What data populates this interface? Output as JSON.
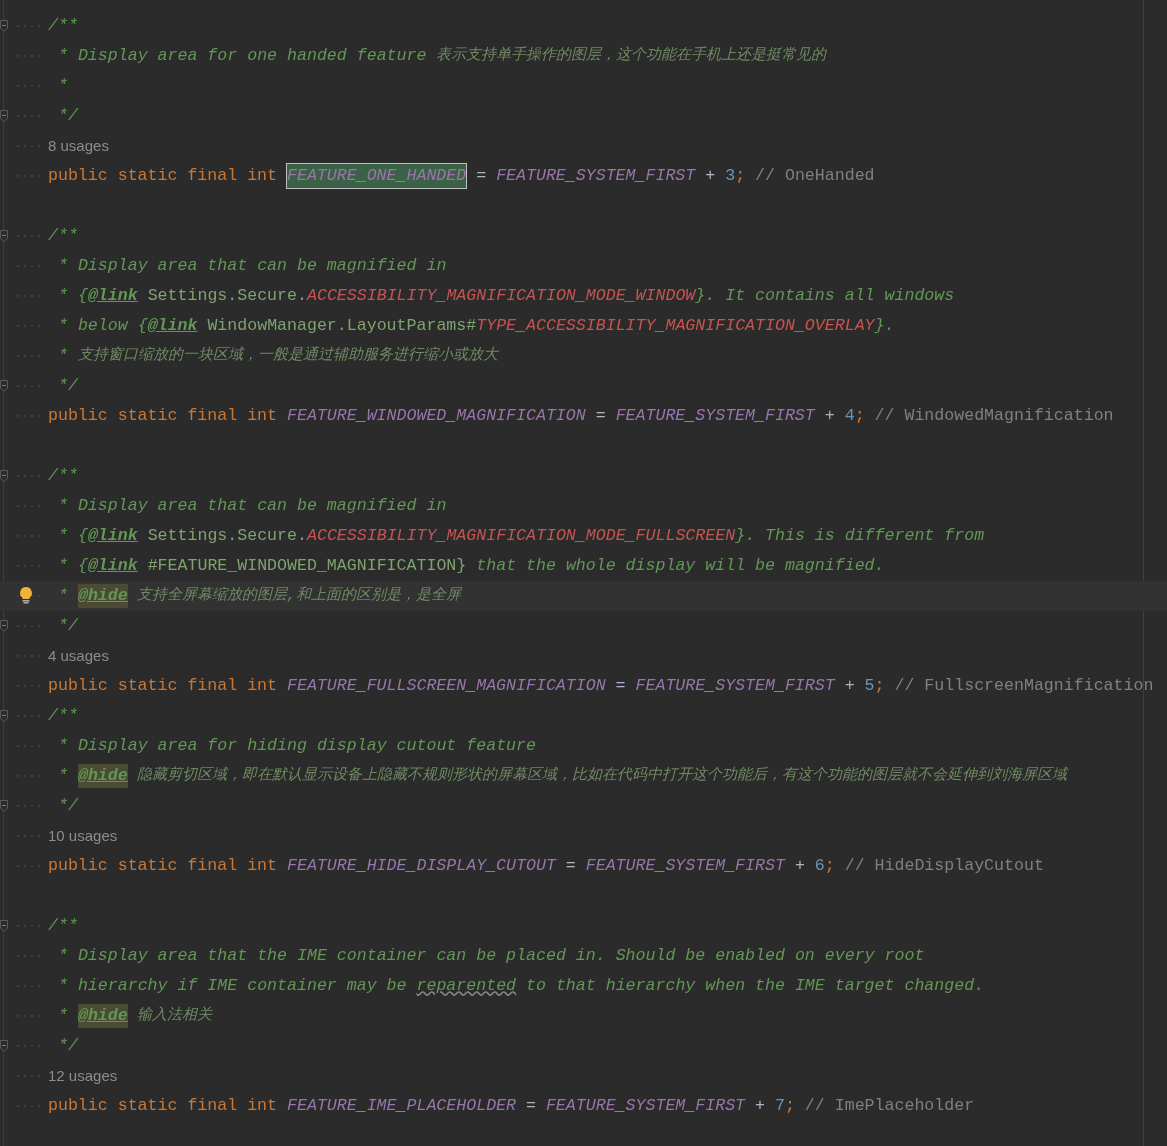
{
  "editor": {
    "lines": [
      {
        "kind": "doc_open",
        "tokens": [
          {
            "kind": "comment",
            "text": "/**"
          }
        ]
      },
      {
        "kind": "doc",
        "tokens": [
          {
            "kind": "comment",
            "text": "* Display area for one handed feature "
          },
          {
            "kind": "cn",
            "text": "表示支持单手操作的图层，这个功能在手机上还是挺常见的"
          }
        ]
      },
      {
        "kind": "doc",
        "tokens": [
          {
            "kind": "comment",
            "text": "*"
          }
        ]
      },
      {
        "kind": "doc_close",
        "tokens": [
          {
            "kind": "comment",
            "text": "*/"
          }
        ]
      },
      {
        "kind": "usages",
        "tokens": [
          {
            "kind": "usages",
            "text": "8 usages"
          }
        ]
      },
      {
        "kind": "code",
        "tokens": [
          {
            "kind": "keyword",
            "text": "public static final int "
          },
          {
            "kind": "constant",
            "text": "FEATURE_ONE_HANDED",
            "selected": true
          },
          {
            "kind": "op",
            "text": " = "
          },
          {
            "kind": "constant",
            "text": "FEATURE_SYSTEM_FIRST"
          },
          {
            "kind": "op",
            "text": " + "
          },
          {
            "kind": "number",
            "text": "3"
          },
          {
            "kind": "semi",
            "text": ";"
          },
          {
            "kind": "line_comment",
            "text": " // OneHanded"
          }
        ]
      },
      {
        "kind": "blank"
      },
      {
        "kind": "doc_open",
        "tokens": [
          {
            "kind": "comment",
            "text": "/**"
          }
        ]
      },
      {
        "kind": "doc",
        "tokens": [
          {
            "kind": "comment",
            "text": "* Display area that can be magnified in"
          }
        ]
      },
      {
        "kind": "doc",
        "tokens": [
          {
            "kind": "comment",
            "text": "* {"
          },
          {
            "kind": "tag",
            "text": "@link"
          },
          {
            "kind": "ref",
            "text": " Settings.Secure."
          },
          {
            "kind": "red",
            "text": "ACCESSIBILITY_MAGNIFICATION_MODE_WINDOW"
          },
          {
            "kind": "comment",
            "text": "}. It contains all windows"
          }
        ]
      },
      {
        "kind": "doc",
        "tokens": [
          {
            "kind": "comment",
            "text": "* below {"
          },
          {
            "kind": "tag",
            "text": "@link"
          },
          {
            "kind": "ref",
            "text": " WindowManager.LayoutParams#"
          },
          {
            "kind": "red",
            "text": "TYPE_ACCESSIBILITY_MAGNIFICATION_OVERLAY"
          },
          {
            "kind": "comment",
            "text": "}."
          }
        ]
      },
      {
        "kind": "doc",
        "tokens": [
          {
            "kind": "comment",
            "text": "* "
          },
          {
            "kind": "cn",
            "text": "支持窗口缩放的一块区域，一般是通过辅助服务进行缩小或放大"
          }
        ]
      },
      {
        "kind": "doc_close",
        "tokens": [
          {
            "kind": "comment",
            "text": "*/"
          }
        ]
      },
      {
        "kind": "code",
        "tokens": [
          {
            "kind": "keyword",
            "text": "public static final int "
          },
          {
            "kind": "constant",
            "text": "FEATURE_WINDOWED_MAGNIFICATION",
            "selected": false
          },
          {
            "kind": "op",
            "text": " = "
          },
          {
            "kind": "constant",
            "text": "FEATURE_SYSTEM_FIRST"
          },
          {
            "kind": "op",
            "text": " + "
          },
          {
            "kind": "number",
            "text": "4"
          },
          {
            "kind": "semi",
            "text": ";"
          },
          {
            "kind": "line_comment",
            "text": " // WindowedMagnification"
          }
        ]
      },
      {
        "kind": "blank"
      },
      {
        "kind": "doc_open",
        "tokens": [
          {
            "kind": "comment",
            "text": "/**"
          }
        ]
      },
      {
        "kind": "doc",
        "tokens": [
          {
            "kind": "comment",
            "text": "* Display area that can be magnified in"
          }
        ]
      },
      {
        "kind": "doc",
        "tokens": [
          {
            "kind": "comment",
            "text": "* {"
          },
          {
            "kind": "tag",
            "text": "@link"
          },
          {
            "kind": "ref",
            "text": " Settings.Secure."
          },
          {
            "kind": "red",
            "text": "ACCESSIBILITY_MAGNIFICATION_MODE_FULLSCREEN"
          },
          {
            "kind": "comment",
            "text": "}. This is different from"
          }
        ]
      },
      {
        "kind": "doc",
        "tokens": [
          {
            "kind": "comment",
            "text": "* {"
          },
          {
            "kind": "tag",
            "text": "@link"
          },
          {
            "kind": "ref",
            "text": " #FEATURE_WINDOWED_MAGNIFICATION}"
          },
          {
            "kind": "comment",
            "text": " that the whole display will be magnified."
          }
        ]
      },
      {
        "kind": "doc",
        "current": true,
        "tokens": [
          {
            "kind": "comment",
            "text": "* "
          },
          {
            "kind": "hide",
            "text": "@hide"
          },
          {
            "kind": "cn",
            "text": " 支持全屏幕缩放的图层,和上面的区别是，是全屏"
          }
        ]
      },
      {
        "kind": "doc_close",
        "tokens": [
          {
            "kind": "comment",
            "text": "*/"
          }
        ]
      },
      {
        "kind": "usages",
        "tokens": [
          {
            "kind": "usages",
            "text": "4 usages"
          }
        ]
      },
      {
        "kind": "code",
        "tokens": [
          {
            "kind": "keyword",
            "text": "public static final int "
          },
          {
            "kind": "constant",
            "text": "FEATURE_FULLSCREEN_MAGNIFICATION",
            "selected": false
          },
          {
            "kind": "op",
            "text": " = "
          },
          {
            "kind": "constant",
            "text": "FEATURE_SYSTEM_FIRST"
          },
          {
            "kind": "op",
            "text": " + "
          },
          {
            "kind": "number",
            "text": "5"
          },
          {
            "kind": "semi",
            "text": ";"
          },
          {
            "kind": "line_comment",
            "text": " // FullscreenMagnification"
          }
        ]
      },
      {
        "kind": "doc_open",
        "tokens": [
          {
            "kind": "comment",
            "text": "/**"
          }
        ]
      },
      {
        "kind": "doc",
        "tokens": [
          {
            "kind": "comment",
            "text": "* Display area for hiding display cutout feature"
          }
        ]
      },
      {
        "kind": "doc",
        "tokens": [
          {
            "kind": "comment",
            "text": "* "
          },
          {
            "kind": "hide",
            "text": "@hide"
          },
          {
            "kind": "cn",
            "text": " 隐藏剪切区域，即在默认显示设备上隐藏不规则形状的屏幕区域，比如在代码中打开这个功能后，有这个功能的图层就不会延伸到刘海屏区域"
          }
        ]
      },
      {
        "kind": "doc_close",
        "tokens": [
          {
            "kind": "comment",
            "text": "*/"
          }
        ]
      },
      {
        "kind": "usages",
        "tokens": [
          {
            "kind": "usages",
            "text": "10 usages"
          }
        ]
      },
      {
        "kind": "code",
        "tokens": [
          {
            "kind": "keyword",
            "text": "public static final int "
          },
          {
            "kind": "constant",
            "text": "FEATURE_HIDE_DISPLAY_CUTOUT",
            "selected": false
          },
          {
            "kind": "op",
            "text": " = "
          },
          {
            "kind": "constant",
            "text": "FEATURE_SYSTEM_FIRST"
          },
          {
            "kind": "op",
            "text": " + "
          },
          {
            "kind": "number",
            "text": "6"
          },
          {
            "kind": "semi",
            "text": ";"
          },
          {
            "kind": "line_comment",
            "text": " // HideDisplayCutout"
          }
        ]
      },
      {
        "kind": "blank"
      },
      {
        "kind": "doc_open",
        "tokens": [
          {
            "kind": "comment",
            "text": "/**"
          }
        ]
      },
      {
        "kind": "doc",
        "tokens": [
          {
            "kind": "comment",
            "text": "* Display area that the IME container can be placed in. Should be enabled on every root"
          }
        ]
      },
      {
        "kind": "doc",
        "tokens": [
          {
            "kind": "comment",
            "text": "* hierarchy if IME container may be "
          },
          {
            "kind": "typo",
            "text": "reparented"
          },
          {
            "kind": "comment",
            "text": " to that hierarchy when the IME target changed."
          }
        ]
      },
      {
        "kind": "doc",
        "tokens": [
          {
            "kind": "comment",
            "text": "* "
          },
          {
            "kind": "hide",
            "text": "@hide"
          },
          {
            "kind": "cn",
            "text": " 输入法相关"
          }
        ]
      },
      {
        "kind": "doc_close",
        "tokens": [
          {
            "kind": "comment",
            "text": "*/"
          }
        ]
      },
      {
        "kind": "usages",
        "tokens": [
          {
            "kind": "usages",
            "text": "12 usages"
          }
        ]
      },
      {
        "kind": "code",
        "tokens": [
          {
            "kind": "keyword",
            "text": "public static final int "
          },
          {
            "kind": "constant",
            "text": "FEATURE_IME_PLACEHOLDER",
            "selected": false
          },
          {
            "kind": "op",
            "text": " = "
          },
          {
            "kind": "constant",
            "text": "FEATURE_SYSTEM_FIRST"
          },
          {
            "kind": "op",
            "text": " + "
          },
          {
            "kind": "number",
            "text": "7"
          },
          {
            "kind": "semi",
            "text": ";"
          },
          {
            "kind": "line_comment",
            "text": " // ImePlaceholder"
          }
        ]
      }
    ]
  }
}
